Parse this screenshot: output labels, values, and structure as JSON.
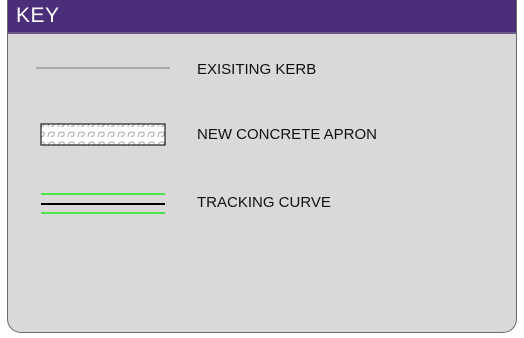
{
  "key": {
    "title": "KEY",
    "items": [
      {
        "label": "EXISITING KERB",
        "symbol": "grey-line",
        "color": "#9a9a9a"
      },
      {
        "label": "NEW CONCRETE APRON",
        "symbol": "hatched-rectangle",
        "color": "#555555"
      },
      {
        "label": "TRACKING CURVE",
        "symbol": "green-black-green-lines",
        "colors": [
          "#39e639",
          "#000000",
          "#39e639"
        ]
      }
    ]
  },
  "colors": {
    "header": "#4b2e7a",
    "panel": "#d9d9d9",
    "border": "#6b6b6b"
  }
}
